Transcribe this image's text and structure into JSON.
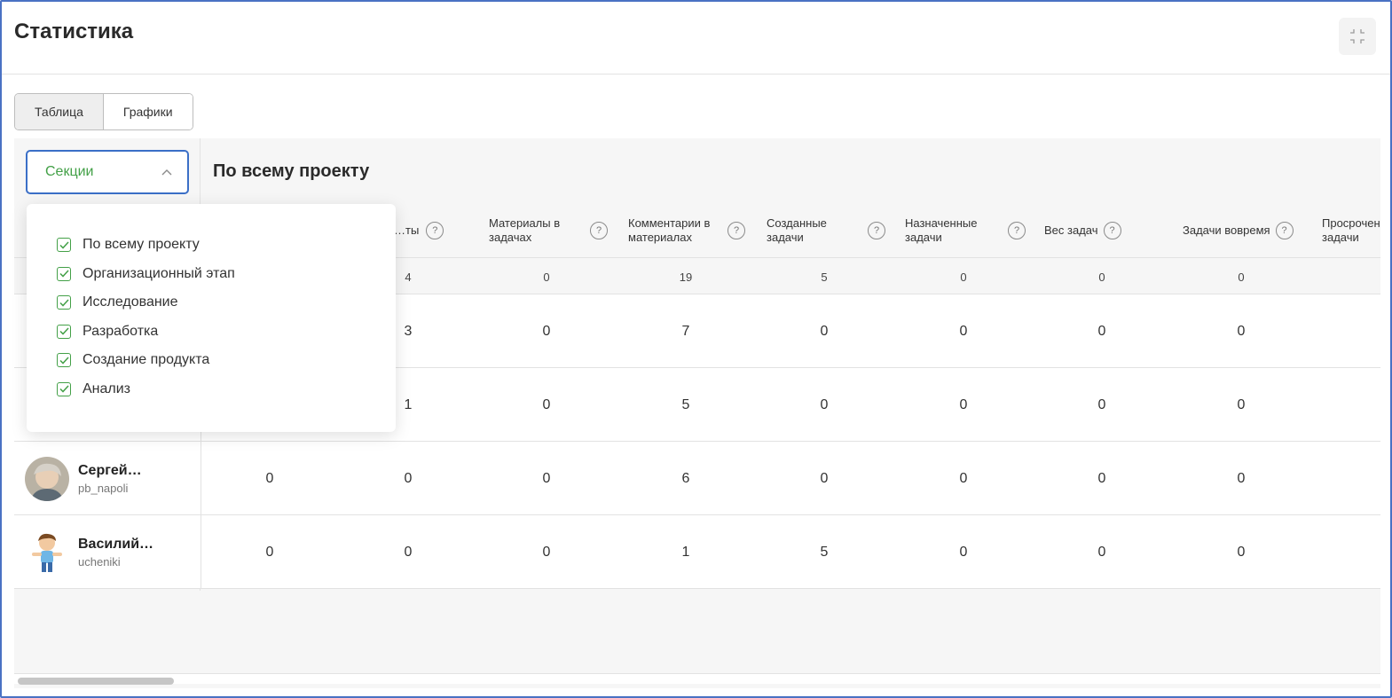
{
  "header": {
    "title": "Статистика"
  },
  "view_toggle": {
    "table_label": "Таблица",
    "charts_label": "Графики"
  },
  "section_select": {
    "label": "Секции"
  },
  "section_title": "По всему проекту",
  "dropdown": {
    "items": [
      {
        "label": "По всему проекту",
        "checked": true
      },
      {
        "label": "Организационный этап",
        "checked": true
      },
      {
        "label": "Исследование",
        "checked": true
      },
      {
        "label": "Разработка",
        "checked": true
      },
      {
        "label": "Создание продукта",
        "checked": true
      },
      {
        "label": "Анализ",
        "checked": true
      }
    ]
  },
  "columns": [
    {
      "label": "…ты"
    },
    {
      "label": "Материалы в задачах"
    },
    {
      "label": "Комментарии в материалах"
    },
    {
      "label": "Созданные задачи"
    },
    {
      "label": "Назначенные задачи"
    },
    {
      "label": "Вес задач"
    },
    {
      "label": "Задачи вовремя"
    },
    {
      "label": "Просрочен… задачи"
    }
  ],
  "totals": [
    "4",
    "0",
    "19",
    "5",
    "0",
    "0",
    "0"
  ],
  "rows": [
    {
      "cells": [
        "3",
        "0",
        "7",
        "0",
        "0",
        "0",
        "0"
      ]
    },
    {
      "cells": [
        "1",
        "0",
        "5",
        "0",
        "0",
        "0",
        "0"
      ]
    },
    {
      "name": "Сергей…",
      "login": "pb_napoli",
      "cells": [
        "0",
        "0",
        "0",
        "6",
        "0",
        "0",
        "0",
        "0"
      ]
    },
    {
      "name": "Василий…",
      "login": "ucheniki",
      "cells": [
        "0",
        "0",
        "0",
        "1",
        "5",
        "0",
        "0",
        "0"
      ]
    }
  ],
  "colors": {
    "accent_blue": "#3b6fc7",
    "accent_green": "#43a047"
  },
  "icons": {
    "collapse": "collapse-icon",
    "chevron": "chevron-up-icon",
    "help": "question-icon",
    "check": "check-icon"
  }
}
